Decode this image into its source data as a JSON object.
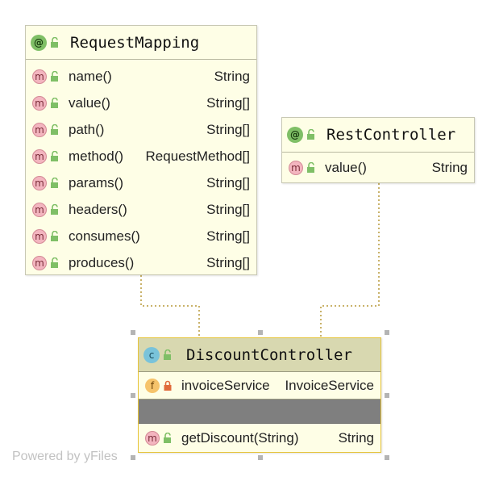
{
  "nodes": {
    "request_mapping": {
      "badge": "@",
      "title": "RequestMapping",
      "rows": [
        {
          "badge": "m",
          "name": "name()",
          "type": "String"
        },
        {
          "badge": "m",
          "name": "value()",
          "type": "String[]"
        },
        {
          "badge": "m",
          "name": "path()",
          "type": "String[]"
        },
        {
          "badge": "m",
          "name": "method()",
          "type": "RequestMethod[]"
        },
        {
          "badge": "m",
          "name": "params()",
          "type": "String[]"
        },
        {
          "badge": "m",
          "name": "headers()",
          "type": "String[]"
        },
        {
          "badge": "m",
          "name": "consumes()",
          "type": "String[]"
        },
        {
          "badge": "m",
          "name": "produces()",
          "type": "String[]"
        }
      ]
    },
    "rest_controller": {
      "badge": "@",
      "title": "RestController",
      "rows": [
        {
          "badge": "m",
          "name": "value()",
          "type": "String"
        }
      ]
    },
    "discount_controller": {
      "badge": "c",
      "title": "DiscountController",
      "field": {
        "badge": "f",
        "name": "invoiceService",
        "type": "InvoiceService"
      },
      "method": {
        "badge": "m",
        "name": "getDiscount(String)",
        "type": "String"
      }
    }
  },
  "colors": {
    "node_fill": "#fefee6",
    "selected_border": "#e6c43a",
    "header_selected": "#d8d8b0",
    "empty_section": "#7f7f7f",
    "edge": "#c9b26a",
    "public_icon": "#7fbf66",
    "private_icon": "#e06a3a"
  },
  "watermark": "Powered by yFiles"
}
